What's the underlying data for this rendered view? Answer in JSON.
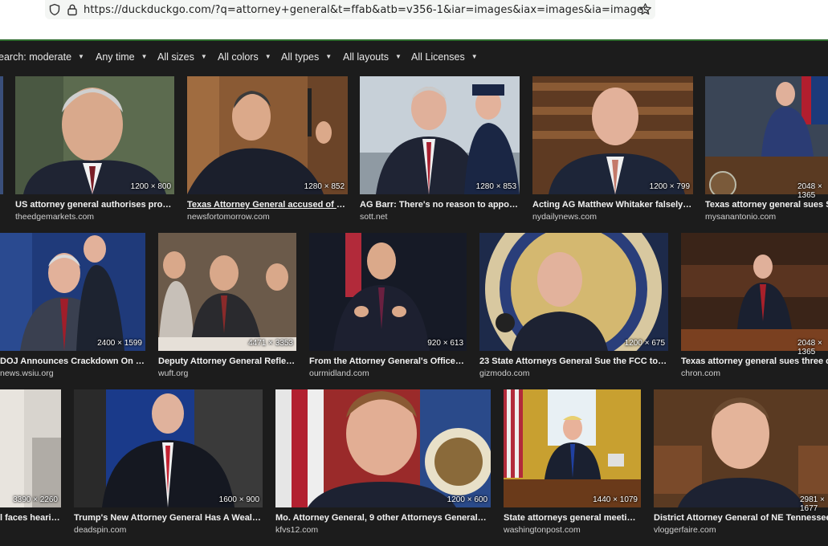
{
  "browser": {
    "url": "https://duckduckgo.com/?q=attorney+general&t=ffab&atb=v356-1&iar=images&iax=images&ia=images",
    "icons": [
      "shield-icon",
      "lock-icon",
      "star-icon"
    ]
  },
  "filters": [
    {
      "label": "earch: moderate"
    },
    {
      "label": "Any time"
    },
    {
      "label": "All sizes"
    },
    {
      "label": "All colors"
    },
    {
      "label": "All types"
    },
    {
      "label": "All layouts"
    },
    {
      "label": "All Licenses"
    }
  ],
  "results": [
    {
      "title": "US attorney general authorises prosec...",
      "source": "theedgemarkets.com",
      "dims": "1200 × 800"
    },
    {
      "title": "Texas Attorney General accused of bre...",
      "source": "newsfortomorrow.com",
      "dims": "1280 × 852"
    },
    {
      "title": "AG Barr: There's no reason to appoint s...",
      "source": "sott.net",
      "dims": "1280 × 853"
    },
    {
      "title": "Acting AG Matthew Whitaker falsely cl...",
      "source": "nydailynews.com",
      "dims": "1200 × 799"
    },
    {
      "title": "Texas attorney general sues SAP",
      "source": "mysanantonio.com",
      "dims": "2048 × 1365"
    },
    {
      "title": "DOJ Announces Crackdown On Lea...",
      "source": "news.wsiu.org",
      "dims": "2400 × 1599"
    },
    {
      "title": "Deputy Attorney General Reflects...",
      "source": "wuft.org",
      "dims": "4471 × 3353"
    },
    {
      "title": "From the Attorney General's Office: H...",
      "source": "ourmidland.com",
      "dims": "920 × 613"
    },
    {
      "title": "23 State Attorneys General Sue the FCC to Pre...",
      "source": "gizmodo.com",
      "dims": "1200 × 675"
    },
    {
      "title": "Texas attorney general sues three con",
      "source": "chron.com",
      "dims": "2048 × 1365"
    },
    {
      "title": "l faces hearin...",
      "source": "",
      "dims": "3390 × 2260"
    },
    {
      "title": "Trump's New Attorney General Has A Wealth ...",
      "source": "deadspin.com",
      "dims": "1600 × 900"
    },
    {
      "title": "Mo. Attorney General, 9 other Attorneys Generals file...",
      "source": "kfvs12.com",
      "dims": "1200 × 600"
    },
    {
      "title": "State attorneys general meeting ...",
      "source": "washingtonpost.com",
      "dims": "1440 × 1079"
    },
    {
      "title": "District Attorney General of NE Tennessee die",
      "source": "vloggerfaire.com",
      "dims": "2981 × 1677"
    }
  ],
  "colors": {
    "page_bg": "#1c1c1c",
    "accent_line": "#2d6a2d",
    "text": "#f2f2f2"
  }
}
